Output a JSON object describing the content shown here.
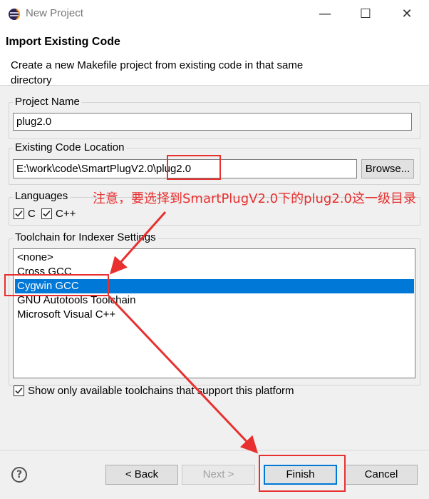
{
  "window": {
    "title": "New Project",
    "controls": {
      "minimize": "—",
      "maximize": "☐",
      "close": "✕"
    }
  },
  "header": {
    "title": "Import Existing Code",
    "description": "Create a new Makefile project from existing code in that same directory"
  },
  "project_name": {
    "label": "Project Name",
    "value": "plug2.0"
  },
  "code_location": {
    "label": "Existing Code Location",
    "value": "E:\\work\\code\\SmartPlugV2.0\\plug2.0",
    "browse_label": "Browse..."
  },
  "languages": {
    "label": "Languages",
    "items": [
      {
        "label": "C",
        "checked": true
      },
      {
        "label": "C++",
        "checked": true
      }
    ]
  },
  "toolchain": {
    "label": "Toolchain for Indexer Settings",
    "items": [
      {
        "label": "<none>"
      },
      {
        "label": "Cross GCC"
      },
      {
        "label": "Cygwin GCC",
        "selected": true
      },
      {
        "label": "GNU Autotools Toolchain"
      },
      {
        "label": "Microsoft Visual C++"
      }
    ],
    "only_available_label": "Show only available toolchains that support this platform",
    "only_available_checked": true
  },
  "footer": {
    "help": "?",
    "back_label": "< Back",
    "next_label": "Next >",
    "finish_label": "Finish",
    "cancel_label": "Cancel"
  },
  "annotation": {
    "text": "注意，要选择到SmartPlugV2.0下的plug2.0这一级目录",
    "color": "#e8302f"
  },
  "colors": {
    "selection": "#0078d7",
    "default_button_border": "#0078d7",
    "annotation_red": "#e8302f"
  }
}
